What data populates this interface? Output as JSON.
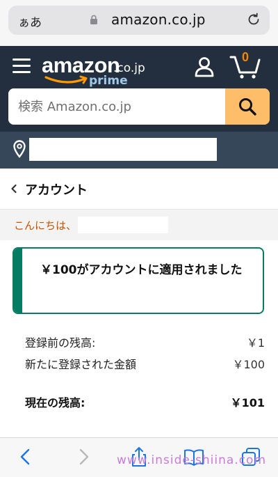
{
  "browser": {
    "text_size_label": "ぁあ",
    "url": "amazon.co.jp"
  },
  "header": {
    "logo_word": "amazon",
    "logo_domain": ".co.jp",
    "logo_prime": "prime",
    "cart_count": "0",
    "search_placeholder": "検索 Amazon.co.jp"
  },
  "account": {
    "title": "アカウント",
    "greeting": "こんにちは、"
  },
  "alert": {
    "message": "￥100がアカウントに適用されました"
  },
  "balance": {
    "rows": [
      {
        "label": "登録前の残高:",
        "value": "￥1"
      },
      {
        "label": "新たに登録された金額",
        "value": "￥100"
      },
      {
        "label": "現在の残高:",
        "value": "￥101"
      }
    ]
  },
  "watermark": "www.inside-shiina.com",
  "colors": {
    "header_bg": "#232f3e",
    "location_bg": "#37475a",
    "search_button": "#febd69",
    "alert_accent": "#067d62",
    "greeting": "#c45500"
  }
}
